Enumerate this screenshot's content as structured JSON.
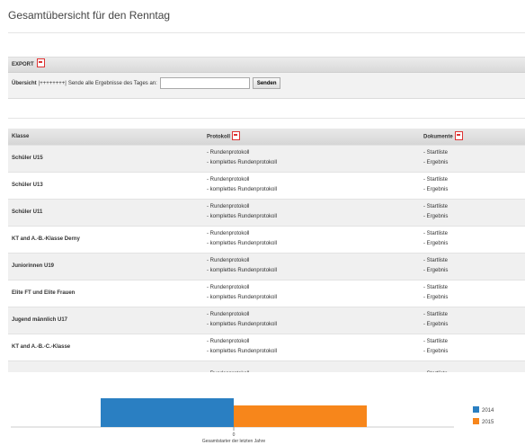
{
  "page": {
    "title": "Gesamtübersicht für den Renntag"
  },
  "export": {
    "heading": "EXPORT",
    "label": "Übersicht",
    "masked": "|++++++++|",
    "text": "Sende alle Ergebnisse des Tages an:",
    "input_value": "",
    "send_label": "Senden",
    "icon": "pdf-icon"
  },
  "table": {
    "headers": {
      "klasse": "Klasse",
      "protokoll": "Protokoll",
      "dokumente": "Dokumente"
    },
    "rows": [
      {
        "klasse": "Schüler U15",
        "p1": "- Rundenprotokoll",
        "p2": "- komplettes Rundenprotokoll",
        "d1": "- Startliste",
        "d2": "- Ergebnis"
      },
      {
        "klasse": "Schüler U13",
        "p1": "- Rundenprotokoll",
        "p2": "- komplettes Rundenprotokoll",
        "d1": "- Startliste",
        "d2": "- Ergebnis"
      },
      {
        "klasse": "Schüler U11",
        "p1": "- Rundenprotokoll",
        "p2": "- komplettes Rundenprotokoll",
        "d1": "- Startliste",
        "d2": "- Ergebnis"
      },
      {
        "klasse": "KT and A.-B.-Klasse Derny",
        "p1": "- Rundenprotokoll",
        "p2": "- komplettes Rundenprotokoll",
        "d1": "- Startliste",
        "d2": "- Ergebnis"
      },
      {
        "klasse": "Juniorinnen U19",
        "p1": "- Rundenprotokoll",
        "p2": "- komplettes Rundenprotokoll",
        "d1": "- Startliste",
        "d2": "- Ergebnis"
      },
      {
        "klasse": "Elite FT und Elite Frauen",
        "p1": "- Rundenprotokoll",
        "p2": "- komplettes Rundenprotokoll",
        "d1": "- Startliste",
        "d2": "- Ergebnis"
      },
      {
        "klasse": "Jugend männlich U17",
        "p1": "- Rundenprotokoll",
        "p2": "- komplettes Rundenprotokoll",
        "d1": "- Startliste",
        "d2": "- Ergebnis"
      },
      {
        "klasse": "KT and A.-B.-C.-Klasse",
        "p1": "- Rundenprotokoll",
        "p2": "- komplettes Rundenprotokoll",
        "d1": "- Startliste",
        "d2": "- Ergebnis"
      },
      {
        "klasse": "",
        "p1": "- Rundenprotokoll",
        "p2": "",
        "d1": "- Startliste",
        "d2": ""
      }
    ]
  },
  "chart_data": {
    "type": "bar",
    "categories": [
      "0"
    ],
    "xlabel": "Gesamtstarter der letzten Jahre",
    "series": [
      {
        "name": "2014",
        "color": "#2a7fc2",
        "values": [
          1
        ]
      },
      {
        "name": "2015",
        "color": "#f7861b",
        "values": [
          1
        ]
      }
    ],
    "legend": "right"
  }
}
